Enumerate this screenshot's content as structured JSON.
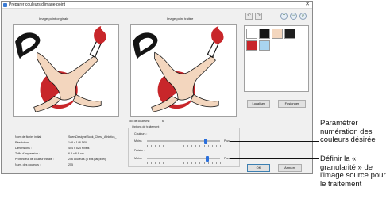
{
  "dialog": {
    "title": "Préparer couleurs d'image-point",
    "close_glyph": "✕"
  },
  "images": {
    "original_caption": "Image-point originale",
    "processed_caption": "Image-point traitée"
  },
  "toolbar": {
    "undo_glyph": "↶",
    "redo_glyph": "↷",
    "zoom_in_glyph": "+",
    "zoom_out_glyph": "−",
    "zoom_fit_glyph": "⌕"
  },
  "palette": {
    "colors": [
      "#ffffff",
      "#141414",
      "#f3d6be",
      "#1e1e1e",
      "#c8262a",
      "#a9d4f0"
    ]
  },
  "palette_buttons": {
    "select": "Localiser",
    "merge": "Fusionner"
  },
  "info": {
    "rows": [
      {
        "label": "Nom de fichier initial:",
        "value": "Snen\\Designs\\Book_Chest_Athletics_"
      },
      {
        "label": "Résolution",
        "value": "148 x 148 DPI"
      },
      {
        "label": "Dimensions :",
        "value": "404 x 524 Pixels"
      },
      {
        "label": "Taille d'impression :",
        "value": "6.8 x 8.9 cm"
      },
      {
        "label": "Profondeur de couleur initiale :",
        "value": "256 couleurs (8 bits par pixel)"
      },
      {
        "label": "Num. des couleurs :",
        "value": "255"
      }
    ]
  },
  "options": {
    "num_colors_label": "No. de couleurs :",
    "num_colors_value": "6",
    "group_title": "Options de traitement",
    "colors_label": "Couleurs :",
    "detail_label": "Détails :",
    "less": "Moins",
    "more": "Plus",
    "colors_level": 0.8,
    "detail_level": 0.83
  },
  "dialog_buttons": {
    "ok": "OK",
    "cancel": "Annuler"
  },
  "annotations": {
    "colors": "Paramétrer numération des couleurs désirée",
    "granularity": "Définir la « granularité » de l'image source pour le traitement"
  }
}
